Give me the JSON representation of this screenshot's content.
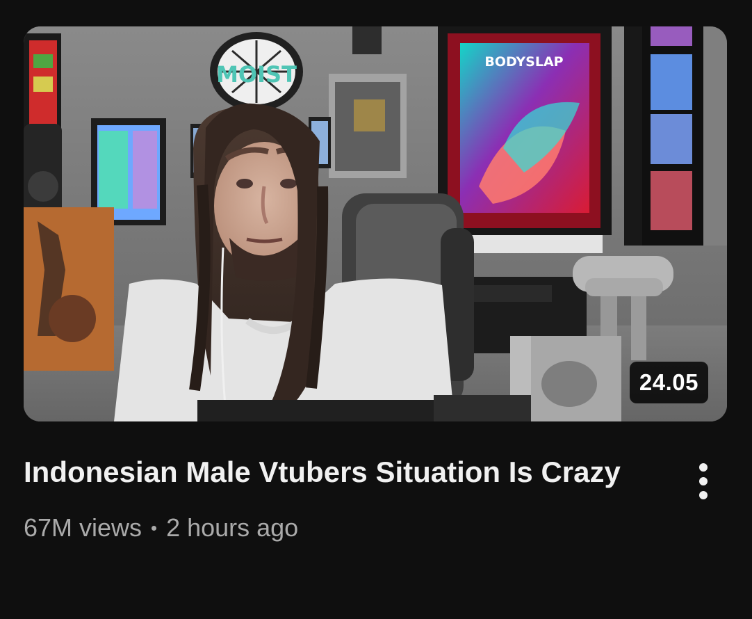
{
  "video": {
    "duration": "24.05",
    "title": "Indonesian Male Vtubers Situation Is Crazy",
    "views": "67M views",
    "separator": "•",
    "uploaded": "2 hours ago",
    "thumbnail_sign": "MOIST",
    "poster_text": "BODYSLAP",
    "more_icon": "more-vert-icon"
  },
  "colors": {
    "background": "#0f0f0f",
    "title": "#f1f1f1",
    "meta": "#aaaaaa",
    "badge_bg": "#000000"
  }
}
